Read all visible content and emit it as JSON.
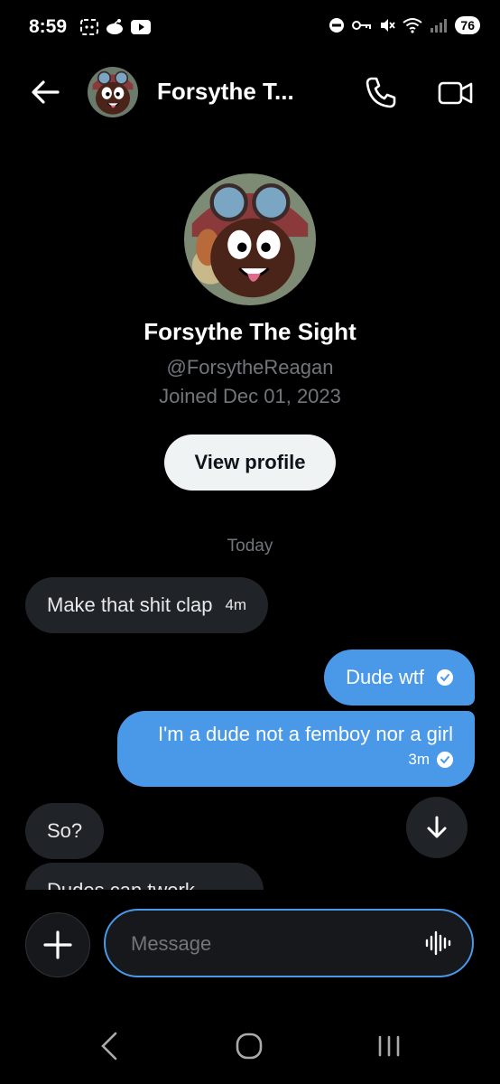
{
  "status_bar": {
    "time": "8:59",
    "battery": "76"
  },
  "header": {
    "title": "Forsythe T..."
  },
  "profile": {
    "name": "Forsythe The Sight",
    "handle": "@ForsytheReagan",
    "joined": "Joined Dec 01, 2023",
    "view_profile_label": "View profile"
  },
  "day_separator": "Today",
  "messages": [
    {
      "direction": "received",
      "text": "Make that shit clap",
      "time": "4m"
    },
    {
      "direction": "sent",
      "text": "Dude wtf"
    },
    {
      "direction": "sent",
      "text": "I'm a dude not a femboy nor a girl",
      "time": "3m"
    },
    {
      "direction": "received",
      "text": "So?"
    },
    {
      "direction": "received",
      "text": "Dudes can twerk"
    }
  ],
  "composer": {
    "placeholder": "Message"
  },
  "colors": {
    "accent": "#4a99e9",
    "received_bubble": "#202327",
    "background": "#000000"
  }
}
